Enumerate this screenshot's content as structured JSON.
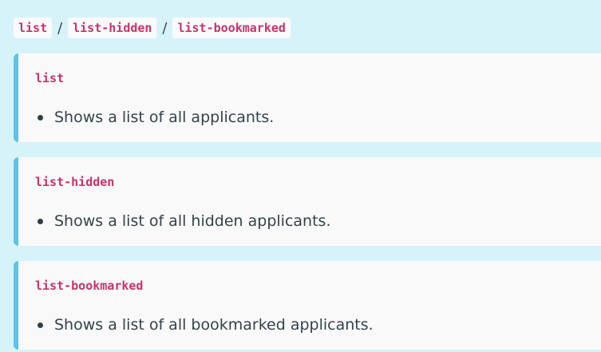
{
  "breadcrumb": {
    "items": [
      "list",
      "list-hidden",
      "list-bookmarked"
    ],
    "separator": "/"
  },
  "cards": [
    {
      "title": "list",
      "items": [
        "Shows a list of all applicants."
      ]
    },
    {
      "title": "list-hidden",
      "items": [
        "Shows a list of all hidden applicants."
      ]
    },
    {
      "title": "list-bookmarked",
      "items": [
        "Shows a list of all bookmarked applicants."
      ]
    }
  ],
  "colors": {
    "background": "#d6f3fa",
    "card": "#f9f9f9",
    "accent_border": "#59c5e6",
    "code_text": "#c7336b",
    "body_text": "#34434a"
  }
}
